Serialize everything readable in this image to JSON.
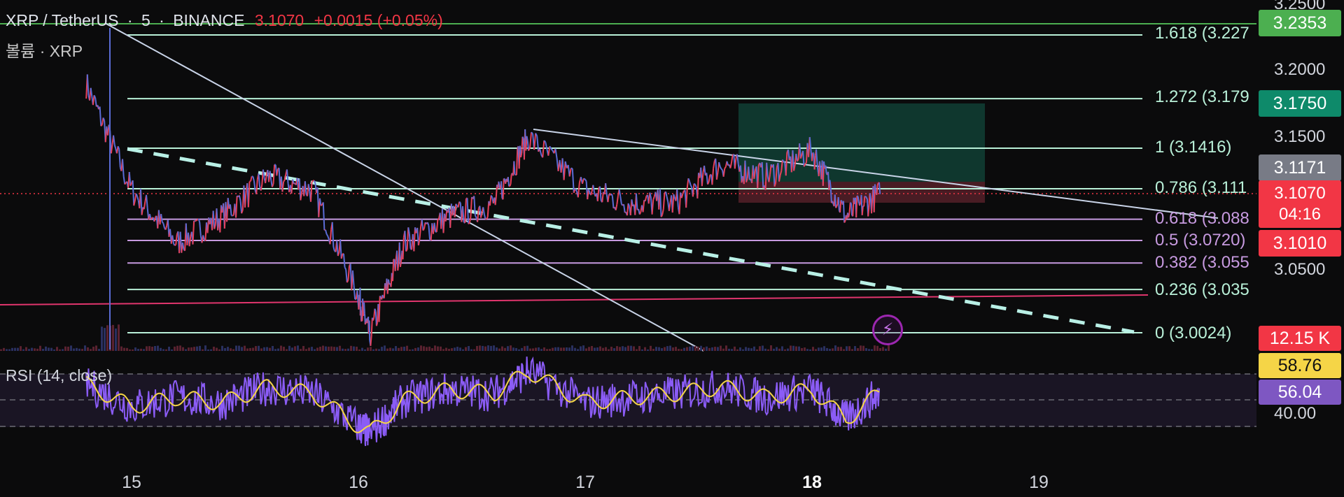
{
  "header": {
    "symbol": "XRP / TetherUS",
    "interval": "5",
    "exchange": "BINANCE",
    "sep": "·",
    "last_price": "3.1070",
    "change": "+0.0015 (+0.05%)",
    "volume_label": "볼륨 · XRP"
  },
  "rsi": {
    "label": "RSI (14, close)"
  },
  "price_axis": [
    "3.2500",
    "3.2000",
    "3.1500",
    "3.0500",
    "40.00"
  ],
  "badges": {
    "alert_high": "3.2353",
    "target": "3.1750",
    "entry": "3.1171",
    "last": "3.1070",
    "countdown": "04:16",
    "stop": "3.1010",
    "volume": "12.15 K",
    "rsi_ma": "58.76",
    "rsi": "56.04"
  },
  "fib_labels": [
    "1.618 (3.227",
    "1.272 (3.179",
    "1 (3.1416)",
    "0.786 (3.111",
    "0.618 (3.088",
    "0.5 (3.0720)",
    "0.382 (3.055",
    "0.236 (3.035",
    "0 (3.0024)"
  ],
  "x_ticks": [
    "15",
    "16",
    "17",
    "18",
    "19"
  ],
  "colors": {
    "background": "#0b0b0c",
    "up_candle": "#e8405a",
    "down_candle": "#5b6cd6",
    "fib_green": "#b9f0d8",
    "fib_purple": "#c79ae0",
    "rsi_line": "#8b5cf6",
    "rsi_ma": "#f5d547",
    "alert_line": "#4caf50",
    "support_line": "#e0356d",
    "target_zone": "#103a30",
    "stop_zone": "#4d1e26"
  },
  "icons": {
    "alert": "lightning-icon"
  },
  "chart_data": {
    "type": "line",
    "title": "XRP / TetherUS · 5 · BINANCE",
    "x": [
      "14.8",
      "15.0",
      "15.2",
      "15.4",
      "15.6",
      "15.8",
      "16.0",
      "16.05",
      "16.2",
      "16.4",
      "16.6",
      "16.75",
      "17.0",
      "17.2",
      "17.4",
      "17.6",
      "17.8",
      "18.0",
      "18.15",
      "18.3"
    ],
    "series": [
      {
        "name": "XRP / TetherUS",
        "values": [
          3.19,
          3.11,
          3.07,
          3.09,
          3.12,
          3.11,
          3.03,
          3.0,
          3.07,
          3.09,
          3.1,
          3.15,
          3.11,
          3.1,
          3.1,
          3.13,
          3.12,
          3.14,
          3.09,
          3.107
        ]
      },
      {
        "name": "RSI (14, close)",
        "values": [
          62,
          45,
          52,
          48,
          60,
          55,
          30,
          25,
          50,
          58,
          55,
          72,
          48,
          52,
          55,
          60,
          52,
          58,
          35,
          56
        ]
      }
    ],
    "fib_levels": [
      {
        "ratio": "1.618",
        "price": 3.227
      },
      {
        "ratio": "1.272",
        "price": 3.179
      },
      {
        "ratio": "1",
        "price": 3.1416
      },
      {
        "ratio": "0.786",
        "price": 3.111
      },
      {
        "ratio": "0.618",
        "price": 3.088
      },
      {
        "ratio": "0.5",
        "price": 3.072
      },
      {
        "ratio": "0.382",
        "price": 3.055
      },
      {
        "ratio": "0.236",
        "price": 3.035
      },
      {
        "ratio": "0",
        "price": 3.0024
      }
    ],
    "ylim": [
      2.995,
      3.255
    ],
    "rsi_levels": [
      70,
      50,
      30
    ],
    "xlabel": "",
    "ylabel": ""
  }
}
